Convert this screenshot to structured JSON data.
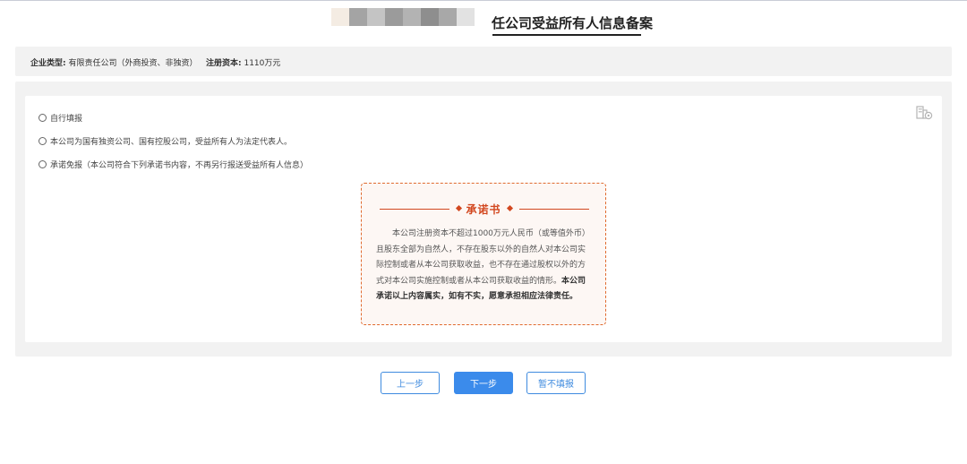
{
  "page": {
    "title": "任公司受益所有人信息备案"
  },
  "info_bar": {
    "company_type_label": "企业类型:",
    "company_type_value": "有限责任公司（外商投资、非独资）",
    "capital_label": "注册资本:",
    "capital_value": "1110万元"
  },
  "options": [
    {
      "label": "自行填报",
      "checked": false
    },
    {
      "label": "本公司为国有独资公司、国有控股公司，受益所有人为法定代表人。",
      "checked": false
    },
    {
      "label": "承诺免报（本公司符合下列承诺书内容，不再另行报送受益所有人信息）",
      "checked": false
    }
  ],
  "promise": {
    "title": "承诺书",
    "lines": [
      "本公司注册资本不超过1000万元人民币（或等值外币）",
      "且股东全部为自然人，不存在股东以外的自然人对本公司实",
      "际控制或者从本公司获取收益，也不存在通过股权以外的方",
      "式对本公司实施控制或者从本公司获取收益的情形。"
    ],
    "bold_tail_1": "本公司",
    "bold_line_2": "承诺以上内容属实，如有不实，愿意承担相应法律责任。"
  },
  "buttons": {
    "prev": "上一步",
    "next": "下一步",
    "skip": "暂不填报"
  },
  "colors": {
    "accent_blue": "#3b8beb",
    "promise_red": "#d2471f",
    "panel_gray": "#f2f2f2"
  },
  "icons": {
    "corner": "building-settings-icon"
  }
}
